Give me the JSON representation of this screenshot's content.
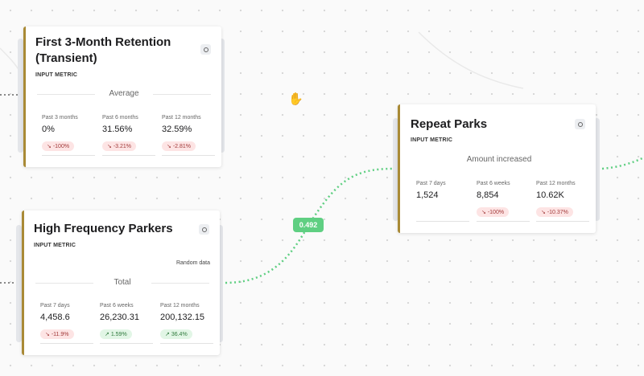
{
  "colors": {
    "card_accent": "#a98a36",
    "edge_green": "#5fcf82",
    "edge_gray": "#888888",
    "negative_badge_bg": "#fde4e4",
    "negative_badge_text": "#a23a3a",
    "positive_badge_bg": "#e2f6e6",
    "positive_badge_text": "#2f7a3d"
  },
  "cursor": {
    "icon": "grab-hand-icon",
    "glyph": "✋"
  },
  "edge": {
    "weight_label": "0.492"
  },
  "cards": {
    "retention": {
      "title_line1": "First 3-Month Retention",
      "title_line2": "(Transient)",
      "subtitle": "INPUT METRIC",
      "aggregation": "Average",
      "metrics": [
        {
          "period": "Past 3 months",
          "value": "0%",
          "change": "-100%",
          "direction": "down"
        },
        {
          "period": "Past 6 months",
          "value": "31.56%",
          "change": "-3.21%",
          "direction": "down"
        },
        {
          "period": "Past 12 months",
          "value": "32.59%",
          "change": "-2.81%",
          "direction": "down"
        }
      ]
    },
    "high_frequency": {
      "title": "High Frequency Parkers",
      "subtitle": "INPUT METRIC",
      "note": "Random data",
      "aggregation": "Total",
      "metrics": [
        {
          "period": "Past 7 days",
          "value": "4,458.6",
          "change": "-11.9%",
          "direction": "down"
        },
        {
          "period": "Past 6 weeks",
          "value": "26,230.31",
          "change": "1.59%",
          "direction": "up"
        },
        {
          "period": "Past 12 months",
          "value": "200,132.15",
          "change": "36.4%",
          "direction": "up"
        }
      ]
    },
    "repeat_parks": {
      "title": "Repeat Parks",
      "subtitle": "INPUT METRIC",
      "aggregation": "Amount increased",
      "metrics": [
        {
          "period": "Past 7 days",
          "value": "1,524",
          "change": "",
          "direction": "none"
        },
        {
          "period": "Past 6 weeks",
          "value": "8,854",
          "change": "-100%",
          "direction": "down"
        },
        {
          "period": "Past 12 months",
          "value": "10.62K",
          "change": "-10.37%",
          "direction": "down"
        }
      ]
    }
  }
}
